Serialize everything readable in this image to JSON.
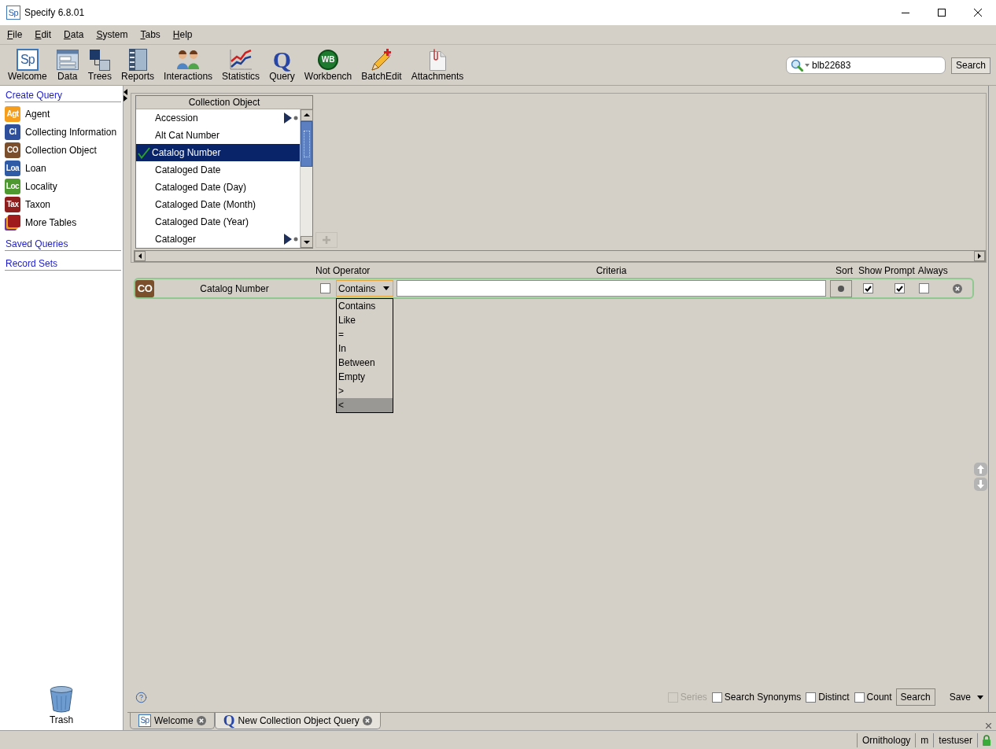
{
  "window": {
    "logo": "Sp",
    "title": "Specify 6.8.01"
  },
  "menu": [
    "File",
    "Edit",
    "Data",
    "System",
    "Tabs",
    "Help"
  ],
  "toolbar": [
    {
      "label": "Welcome",
      "kind": "welcome",
      "badge": "Sp"
    },
    {
      "label": "Data",
      "kind": "data"
    },
    {
      "label": "Trees",
      "kind": "trees"
    },
    {
      "label": "Reports",
      "kind": "reports"
    },
    {
      "label": "Interactions",
      "kind": "interactions"
    },
    {
      "label": "Statistics",
      "kind": "statistics"
    },
    {
      "label": "Query",
      "kind": "query",
      "badge": "Q"
    },
    {
      "label": "Workbench",
      "kind": "workbench",
      "badge": "WB"
    },
    {
      "label": "BatchEdit",
      "kind": "batchedit"
    },
    {
      "label": "Attachments",
      "kind": "attachments"
    }
  ],
  "search": {
    "value": "blb22683",
    "button": "Search"
  },
  "sidebar": {
    "sections": [
      {
        "title": "Create Query",
        "items": [
          {
            "label": "Agent",
            "kind": "table",
            "abbr": "Agt",
            "color": "#f59d1c"
          },
          {
            "label": "Collecting Information",
            "kind": "table",
            "abbr": "CI",
            "color": "#2e4f9c"
          },
          {
            "label": "Collection Object",
            "kind": "table",
            "abbr": "CO",
            "color": "#7b4f2c"
          },
          {
            "label": "Loan",
            "kind": "table",
            "abbr": "Loa",
            "color": "#2f5aa6"
          },
          {
            "label": "Locality",
            "kind": "table",
            "abbr": "Loc",
            "color": "#4f9a30"
          },
          {
            "label": "Taxon",
            "kind": "table",
            "abbr": "Tax",
            "color": "#8e1e1e"
          },
          {
            "label": "More Tables",
            "kind": "more"
          }
        ]
      },
      {
        "title": "Saved Queries"
      },
      {
        "title": "Record Sets"
      }
    ],
    "trash": "Trash"
  },
  "field_list": {
    "title": "Collection Object",
    "items": [
      {
        "label": "Accession",
        "kind": "relation",
        "checked": false,
        "selected": false
      },
      {
        "label": "Alt Cat Number",
        "kind": "field",
        "checked": false,
        "selected": false
      },
      {
        "label": "Catalog Number",
        "kind": "field",
        "checked": true,
        "selected": true
      },
      {
        "label": "Cataloged Date",
        "kind": "field",
        "checked": false,
        "selected": false
      },
      {
        "label": "Cataloged Date (Day)",
        "kind": "field",
        "checked": false,
        "selected": false
      },
      {
        "label": "Cataloged Date (Month)",
        "kind": "field",
        "checked": false,
        "selected": false
      },
      {
        "label": "Cataloged Date (Year)",
        "kind": "field",
        "checked": false,
        "selected": false
      },
      {
        "label": "Cataloger",
        "kind": "relation",
        "checked": false,
        "selected": false
      }
    ]
  },
  "add_field": {
    "disabled": true
  },
  "query_header": [
    "Not Operator",
    "Criteria",
    "Sort",
    "Show",
    "Prompt",
    "Always"
  ],
  "query_rows": [
    {
      "abbr": "CO",
      "color": "#7b4f2c",
      "field": "Catalog Number",
      "not": false,
      "operator": "Contains",
      "sort": {
        "kind": "none"
      },
      "show": true,
      "prompt": true,
      "always": false
    }
  ],
  "operator_menu": [
    {
      "label": "Contains",
      "selected": false
    },
    {
      "label": "Like",
      "selected": false
    },
    {
      "label": "=",
      "selected": false
    },
    {
      "label": "In",
      "selected": false
    },
    {
      "label": "Between",
      "selected": false
    },
    {
      "label": "Empty",
      "selected": false
    },
    {
      "label": ">",
      "selected": false
    },
    {
      "label": "<",
      "selected": true
    }
  ],
  "footer": {
    "options": [
      {
        "label": "Series",
        "checked": false,
        "disabled": true
      },
      {
        "label": "Search Synonyms",
        "checked": false,
        "disabled": false
      },
      {
        "label": "Distinct",
        "checked": false,
        "disabled": false
      },
      {
        "label": "Count",
        "checked": false,
        "disabled": false
      }
    ],
    "search_button": "Search",
    "save_button": "Save"
  },
  "tabs": [
    {
      "label": "Welcome",
      "kind": "welcome",
      "badge": "Sp",
      "selected": false
    },
    {
      "label": "New Collection Object Query",
      "kind": "query",
      "badge": "Q",
      "selected": true
    }
  ],
  "status_bar": [
    "Ornithology",
    "m",
    "testuser"
  ]
}
